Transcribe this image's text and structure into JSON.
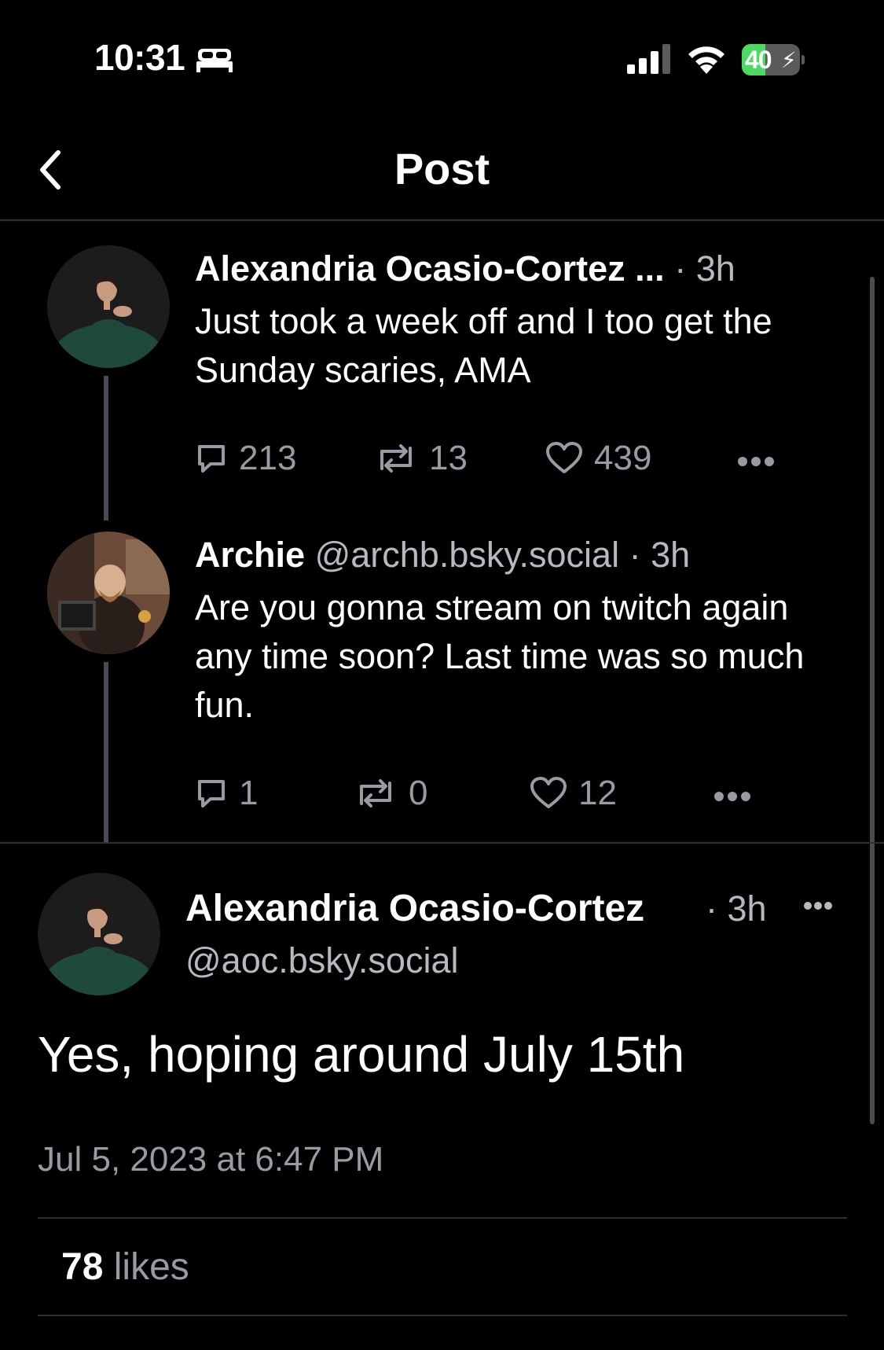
{
  "status_bar": {
    "time": "10:31",
    "battery": "40",
    "battery_level": 0.4,
    "accent": "#4cd964"
  },
  "header": {
    "title": "Post"
  },
  "thread": [
    {
      "author": "Alexandria Ocasio-Cortez ...",
      "handle": "",
      "time": "3h",
      "text": "Just took a week off and I too get the Sunday scaries, AMA",
      "replies": "213",
      "reposts": "13",
      "likes": "439"
    },
    {
      "author": "Archie",
      "handle": "@archb.bsky.social",
      "time": "3h",
      "text": "Are you gonna stream on twitch again any time soon? Last time was so much fun.",
      "replies": "1",
      "reposts": "0",
      "likes": "12"
    }
  ],
  "main_post": {
    "author": "Alexandria Ocasio-Cortez",
    "time": "3h",
    "handle": "@aoc.bsky.social",
    "text": "Yes, hoping around July 15th",
    "date": "Jul 5, 2023 at 6:47 PM",
    "likes_count": "78",
    "likes_label": "likes"
  },
  "icons": [
    "bed-icon",
    "signal-icon",
    "wifi-icon",
    "battery-icon",
    "back-chevron-icon",
    "reply-icon",
    "repost-icon",
    "heart-icon",
    "more-icon"
  ],
  "colors": {
    "background": "#000000",
    "text": "#ffffff",
    "muted": "#9a9aa4",
    "thread_line": "#4a4a55"
  }
}
